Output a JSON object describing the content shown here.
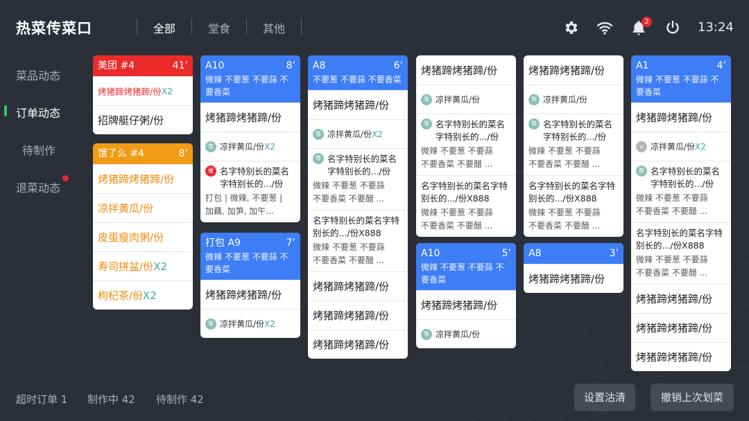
{
  "header": {
    "title": "热菜传菜口",
    "tabs": [
      "全部",
      "堂食",
      "其他"
    ],
    "notification_count": "2",
    "time": "13:24"
  },
  "sidebar": {
    "items": [
      "菜品动态",
      "订单动态",
      "待制作",
      "退菜动态"
    ]
  },
  "colors": {
    "accent_blue": "#3d7df5",
    "meituan_red": "#ed2a2a",
    "eleme_orange": "#f29b16",
    "active_green": "#2ac769"
  },
  "cards": {
    "c1": {
      "title": "美团 #4",
      "time": "41’",
      "dish1": "烤猪蹄烤猪蹄/份",
      "dish1_mul": "X2",
      "dish2": "招牌艇仔粥/份"
    },
    "c2": {
      "title": "饿了么 #4",
      "time": "8’",
      "dish1": "烤猪蹄烤猪蹄/份",
      "dish2": "凉拌黄瓜/份",
      "dish3": "皮蛋瘦肉粥/份",
      "dish4": "寿司拼盆/份",
      "dish4_mul": "X2",
      "dish5": "枸杞茶/份",
      "dish5_mul": "X2"
    },
    "c3": {
      "title": "A10",
      "time": "8’",
      "note": "微辣 不要葱 不要蒜 不要香菜",
      "dish1": "烤猪蹄烤猪蹄/份",
      "tag": "等",
      "dish2": "凉拌黄瓜/份",
      "dish2_mul": "X2",
      "tag2": "催",
      "long_name": "名字特别长的菜名字特别长的.../份",
      "long_note1": "打包 | 微辣, 不要葱 |",
      "long_note2": "加藕, 加笋, 加午..."
    },
    "c4": {
      "title": "打包 A9",
      "time": "7’",
      "note": "微辣 不要葱 不要蒜 不要香菜",
      "dish1": "烤猪蹄烤猪蹄/份",
      "tag": "等",
      "dish2": "凉拌黄瓜/份",
      "dish2_mul": "X2"
    },
    "c5": {
      "title": "A8",
      "time": "6’",
      "note": "不要葱 不要蒜 不要香菜",
      "dish1": "烤猪蹄烤猪蹄/份",
      "tag": "等",
      "dish2": "凉拌黄瓜/份",
      "dish2_mul": "X2",
      "long_name": "名字特别长的菜名字特别长的.../份",
      "long_note1": "微辣 不要葱 不要蒜",
      "long_note2": "不要香菜 不要醋 ...",
      "long2_name": "名字特别长的菜名字特别长的.../份X888",
      "long2_note1": "微辣 不要葱 不要蒜",
      "long2_note2": "不要香菜 不要醋 ...",
      "dish3": "烤猪蹄烤猪蹄/份",
      "dish4": "烤猪蹄烤猪蹄/份",
      "dish5": "烤猪蹄烤猪蹄/份"
    },
    "c6": {
      "dish1": "烤猪蹄烤猪蹄/份",
      "tag": "等",
      "dish2": "凉拌黄瓜/份",
      "long_name": "名字特别长的菜名字特别长的.../份",
      "long_note1": "微辣 不要葱 不要蒜",
      "long_note2": "不要香菜 不要醋 ...",
      "long2_name": "名字特别长的菜名字特别长的.../份X888",
      "long2_note1": "微辣 不要葱 不要蒜",
      "long2_note2": "不要香菜 不要醋 ..."
    },
    "c7": {
      "title": "A10",
      "time": "5’",
      "note": "微辣 不要葱 不要蒜 不要香菜",
      "dish1": "烤猪蹄烤猪蹄/份",
      "tag": "等",
      "dish2": "凉拌黄瓜/份"
    },
    "c8": {
      "dish1": "烤猪蹄烤猪蹄/份",
      "tag": "等",
      "dish2": "凉拌黄瓜/份",
      "long_name": "名字特别长的菜名字特别长的.../份",
      "long_note1": "微辣 不要葱 不要蒜",
      "long_note2": "不要香菜 不要醋 ...",
      "long2_name": "名字特别长的菜名字特别长的.../份X888",
      "long2_note1": "微辣 不要葱 不要蒜",
      "long2_note2": "不要香菜 不要醋 ..."
    },
    "c9": {
      "title": "A8",
      "time": "3’",
      "dish1": "烤猪蹄烤猪蹄/份"
    },
    "c10": {
      "title": "A1",
      "time": "4’",
      "note": "微辣 不要葱 不要蒜 不要香菜",
      "dish1": "烤猪蹄烤猪蹄/份",
      "tag": "⌂",
      "dish2": "凉拌黄瓜/份",
      "dish2_mul": "X2",
      "tag2": "等",
      "long_name": "名字特别长的菜名字特别长的.../份",
      "long_note1": "微辣 不要葱 不要蒜",
      "long_note2": "不要香菜 不要醋 ...",
      "long2_name": "名字特别长的菜名字特别长的.../份X888",
      "long2_note1": "微辣 不要葱 不要蒜",
      "long2_note2": "不要香菜 不要醋 ...",
      "dish3": "烤猪蹄烤猪蹄/份",
      "dish4": "烤猪蹄烤猪蹄/份",
      "dish5": "烤猪蹄烤猪蹄/份"
    }
  },
  "footer": {
    "overdue": "超时订单 1",
    "cooking": "制作中 42",
    "pending": "待制作 42",
    "btn_clear": "设置沽清",
    "btn_undo": "撤销上次划菜"
  }
}
